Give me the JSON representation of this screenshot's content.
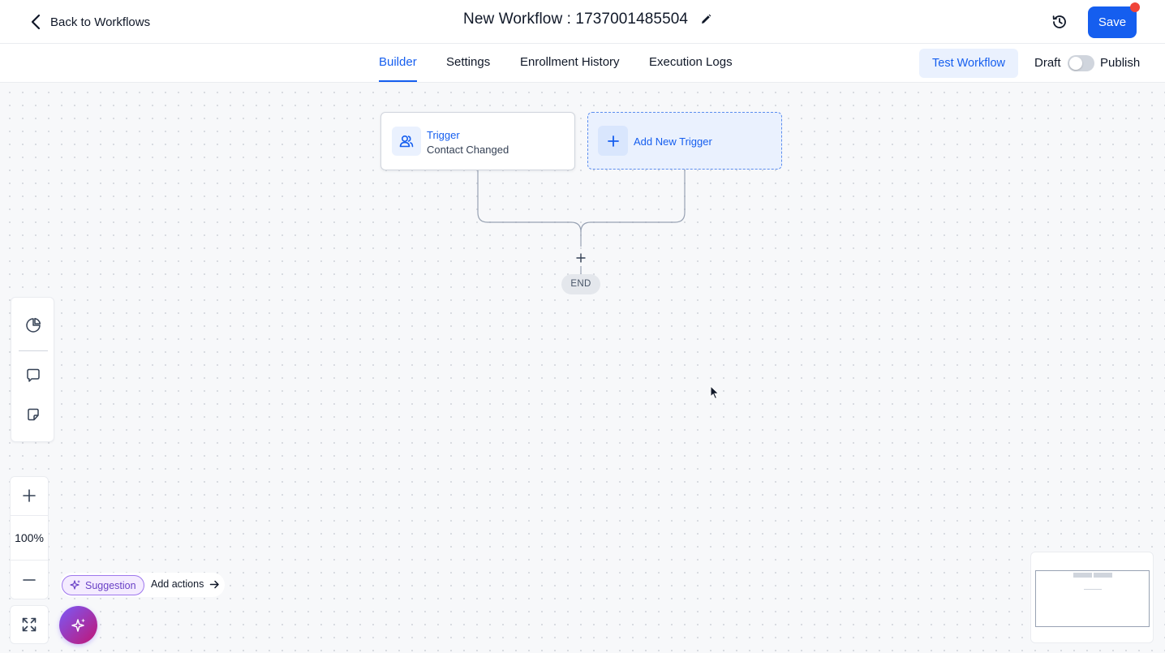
{
  "header": {
    "back_label": "Back to Workflows",
    "title": "New Workflow : 1737001485504",
    "save_label": "Save"
  },
  "tabs": [
    {
      "label": "Builder",
      "active": true
    },
    {
      "label": "Settings",
      "active": false
    },
    {
      "label": "Enrollment History",
      "active": false
    },
    {
      "label": "Execution Logs",
      "active": false
    }
  ],
  "actions": {
    "test_workflow_label": "Test Workflow",
    "draft_label": "Draft",
    "publish_label": "Publish",
    "published": false
  },
  "canvas": {
    "trigger": {
      "title": "Trigger",
      "subtitle": "Contact Changed",
      "icon": "users-icon"
    },
    "add_trigger_label": "Add New Trigger",
    "end_label": "END"
  },
  "zoom": {
    "level": "100%"
  },
  "suggestion": {
    "chip_label": "Suggestion",
    "action_label": "Add actions"
  },
  "icons": [
    "chevron-left-icon",
    "pencil-icon",
    "history-icon",
    "users-icon",
    "plus-icon",
    "pie-chart-icon",
    "comment-icon",
    "sticky-note-icon",
    "zoom-in-icon",
    "zoom-out-icon",
    "expand-icon",
    "sparkle-icon",
    "arrow-right-icon"
  ],
  "colors": {
    "primary": "#155eef",
    "primary_soft": "#eaf1fe",
    "notification": "#f04438",
    "suggestion": "#6941c6",
    "canvas_bg": "#f7f8fa"
  }
}
